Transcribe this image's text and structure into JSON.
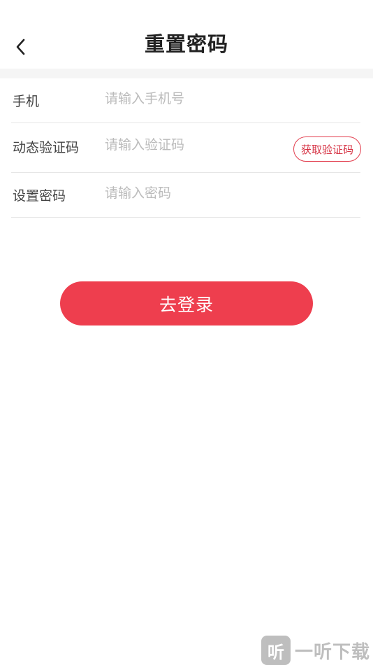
{
  "header": {
    "title": "重置密码",
    "back_icon": "chevron-left-icon"
  },
  "form": {
    "phone": {
      "label": "手机",
      "placeholder": "请输入手机号",
      "value": ""
    },
    "code": {
      "label": "动态验证码",
      "placeholder": "请输入验证码",
      "value": "",
      "get_code_label": "获取验证码"
    },
    "password": {
      "label": "设置密码",
      "placeholder": "请输入密码",
      "value": ""
    }
  },
  "actions": {
    "login_label": "去登录"
  },
  "watermark": {
    "logo_glyph": "听",
    "text": "一听下载"
  },
  "colors": {
    "accent": "#ee3e4e",
    "accent_border": "#e23e4e",
    "title": "#222222",
    "label": "#444444",
    "placeholder": "#bbbbbb",
    "divider": "#e6e6e6",
    "band": "#f5f5f5"
  }
}
